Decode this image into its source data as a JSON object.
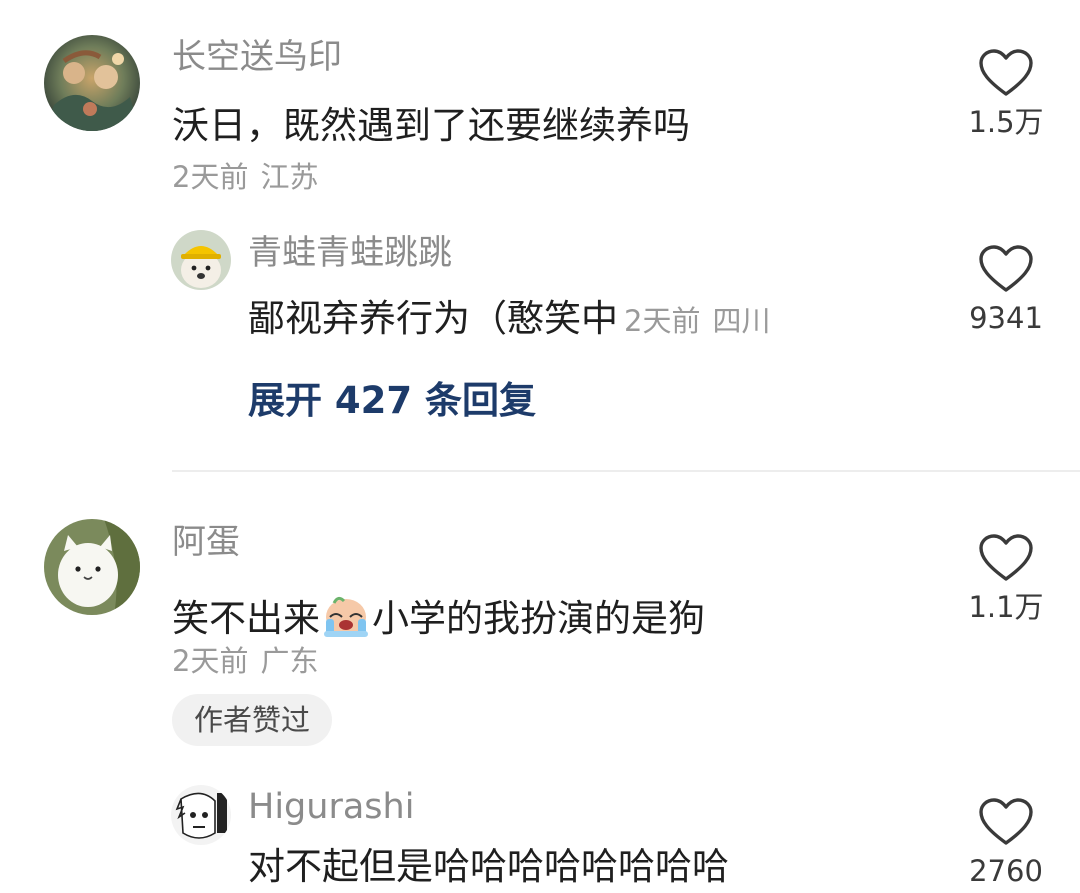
{
  "comments": [
    {
      "author": "长空送鸟印",
      "text": "沃日，既然遇到了还要继续养吗",
      "time": "2天前",
      "location": "江苏",
      "likes": "1.5万",
      "avatar_icon": "painting-avatar",
      "replies": [
        {
          "author": "青蛙青蛙跳跳",
          "text": "鄙视弃养行为（憨笑中",
          "time": "2天前",
          "location": "四川",
          "likes": "9341",
          "avatar_icon": "dog-hardhat-avatar"
        }
      ],
      "expand_label": "展开 427 条回复"
    },
    {
      "author": "阿蛋",
      "text_before": "笑不出来",
      "emoji": "crying-face-emoji",
      "text_after": "小学的我扮演的是狗",
      "time": "2天前",
      "location": "广东",
      "likes": "1.1万",
      "badge": "作者赞过",
      "avatar_icon": "white-cat-avatar",
      "replies": [
        {
          "author": "Higurashi",
          "text": "对不起但是哈哈哈哈哈哈哈哈",
          "likes": "2760",
          "avatar_icon": "manga-face-avatar"
        }
      ]
    }
  ],
  "colors": {
    "name": "#8b8b8b",
    "text": "#1f1f1f",
    "meta": "#9a9a9a",
    "expand": "#1d3b6a",
    "divider": "#ededed",
    "badge_bg": "#f1f1f1"
  }
}
